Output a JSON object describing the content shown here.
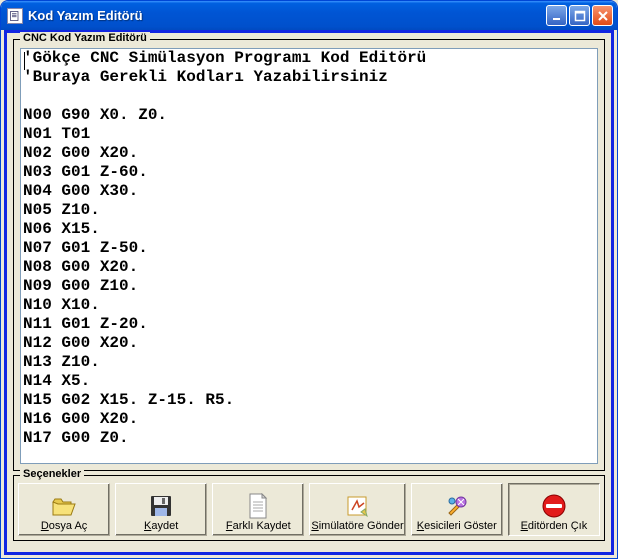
{
  "window": {
    "title": "Kod Yazım Editörü"
  },
  "editor": {
    "legend": "CNC Kod Yazım Editörü",
    "lines": [
      "'Gökçe CNC Simülasyon Programı Kod Editörü",
      "'Buraya Gerekli Kodları Yazabilirsiniz",
      "",
      "N00 G90 X0. Z0.",
      "N01 T01",
      "N02 G00 X20.",
      "N03 G01 Z-60.",
      "N04 G00 X30.",
      "N05 Z10.",
      "N06 X15.",
      "N07 G01 Z-50.",
      "N08 G00 X20.",
      "N09 G00 Z10.",
      "N10 X10.",
      "N11 G01 Z-20.",
      "N12 G00 X20.",
      "N13 Z10.",
      "N14 X5.",
      "N15 G02 X15. Z-15. R5.",
      "N16 G00 X20.",
      "N17 G00 Z0."
    ]
  },
  "options": {
    "legend": "Seçenekler",
    "buttons": {
      "open": {
        "label": "Dosya Aç",
        "accel": "D"
      },
      "save": {
        "label": "Kaydet",
        "accel": "K"
      },
      "saveas": {
        "label": "Farklı Kaydet",
        "accel": "F"
      },
      "send": {
        "label": "Simülatöre Gönder",
        "accel": "S"
      },
      "cutters": {
        "label": "Kesicileri Göster",
        "accel": "K"
      },
      "exit": {
        "label": "Editörden Çık",
        "accel": "E"
      }
    }
  }
}
